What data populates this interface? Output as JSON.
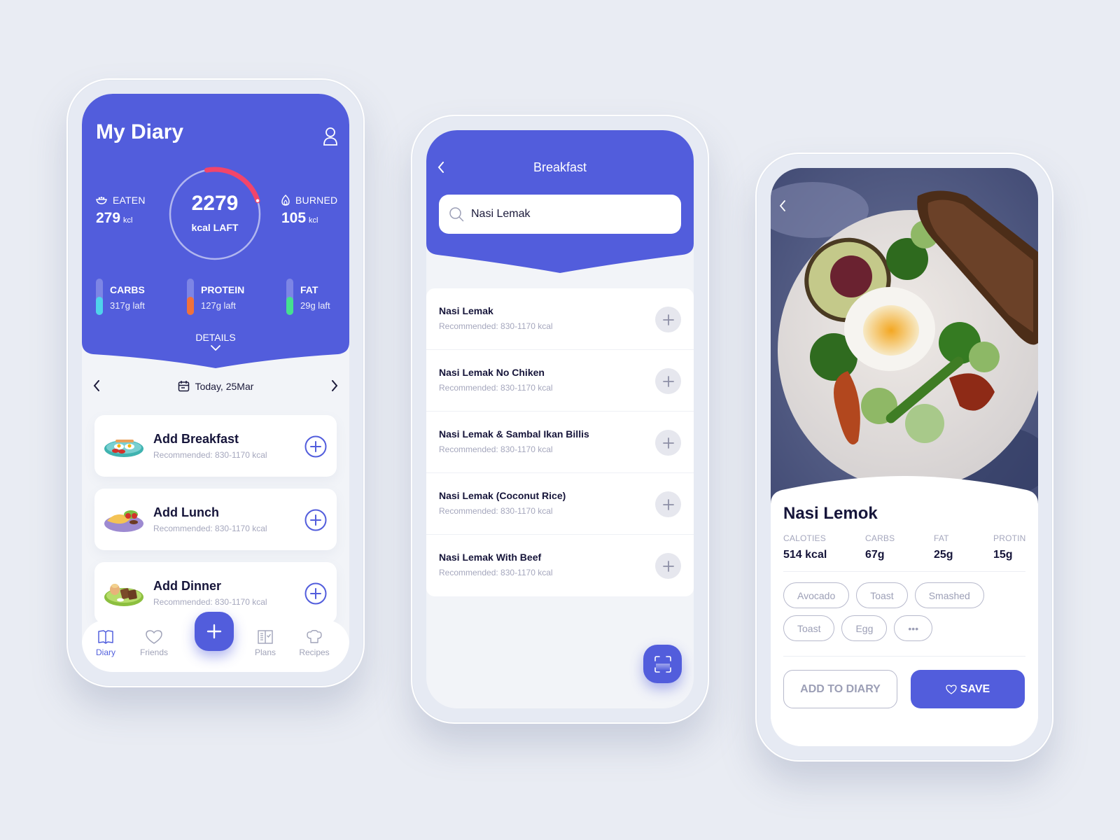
{
  "colors": {
    "accent": "#525ddc",
    "ring_progress": "#f2456b",
    "carbs": "#4fd3ec",
    "protein": "#f0713a",
    "fat": "#45e08f",
    "text_dark": "#16153a",
    "text_muted": "#a5a7bd"
  },
  "diary": {
    "title": "My Diary",
    "eaten": {
      "label": "EATEN",
      "value": "279",
      "unit": "kcl"
    },
    "burned": {
      "label": "BURNED",
      "value": "105",
      "unit": "kcl"
    },
    "ring": {
      "value": "2279",
      "label": "kcal LAFT",
      "progress": 0.23
    },
    "macros": [
      {
        "name": "CARBS",
        "left": "317g laft",
        "fill": 0.5
      },
      {
        "name": "PROTEIN",
        "left": "127g laft",
        "fill": 0.5
      },
      {
        "name": "FAT",
        "left": "29g laft",
        "fill": 0.5
      }
    ],
    "details_label": "DETAILS",
    "date_label": "Today, 25Mar",
    "meals": [
      {
        "title": "Add Breakfast",
        "subtitle": "Recommended: 830-1170 kcal"
      },
      {
        "title": "Add Lunch",
        "subtitle": "Recommended: 830-1170 kcal"
      },
      {
        "title": "Add Dinner",
        "subtitle": "Recommended: 830-1170 kcal"
      }
    ],
    "tabs": [
      {
        "label": "Diary",
        "icon": "book-icon",
        "active": true
      },
      {
        "label": "Friends",
        "icon": "heart-icon",
        "active": false
      },
      {
        "label": "Plans",
        "icon": "checklist-icon",
        "active": false
      },
      {
        "label": "Recipes",
        "icon": "chef-hat-icon",
        "active": false
      }
    ]
  },
  "search_screen": {
    "title": "Breakfast",
    "search_value": "Nasi Lemak",
    "results": [
      {
        "title": "Nasi Lemak",
        "subtitle": "Recommended: 830-1170 kcal"
      },
      {
        "title": "Nasi Lemak No Chiken",
        "subtitle": "Recommended: 830-1170 kcal"
      },
      {
        "title": "Nasi Lemak & Sambal Ikan Billis",
        "subtitle": "Recommended: 830-1170 kcal"
      },
      {
        "title": "Nasi Lemak (Coconut Rice)",
        "subtitle": "Recommended: 830-1170 kcal"
      },
      {
        "title": "Nasi Lemak With Beef",
        "subtitle": "Recommended: 830-1170 kcal"
      }
    ]
  },
  "food_detail": {
    "name": "Nasi Lemok",
    "nutrition": [
      {
        "label": "CALOTIES",
        "value": "514 kcal"
      },
      {
        "label": "CARBS",
        "value": "67g"
      },
      {
        "label": "FAT",
        "value": "25g"
      },
      {
        "label": "PROTIN",
        "value": "15g"
      }
    ],
    "tags": [
      "Avocado",
      "Toast",
      "Smashed",
      "Toast",
      "Egg",
      "•••"
    ],
    "add_to_diary_label": "ADD TO DIARY",
    "save_label": "SAVE"
  }
}
